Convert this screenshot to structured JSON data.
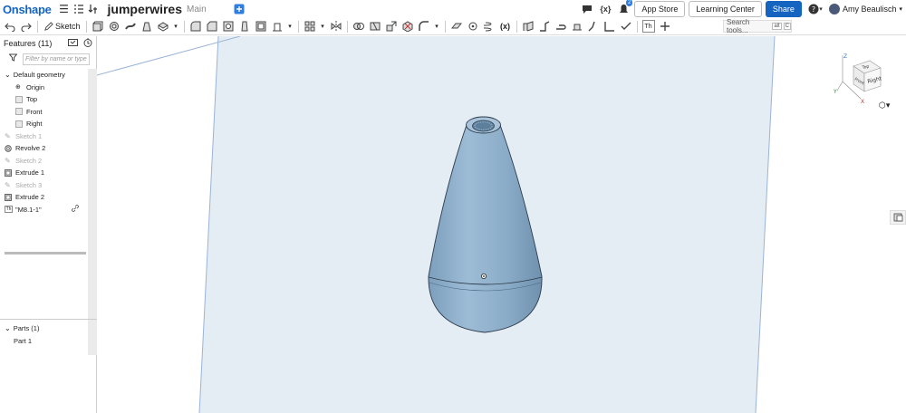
{
  "app": {
    "logo": "Onshape",
    "doc_name": "jumperwires",
    "branch": "Main"
  },
  "topbar": {
    "notification_count": "2",
    "app_store_label": "App Store",
    "learning_center_label": "Learning Center",
    "share_label": "Share",
    "user_name": "Amy Beaulisch"
  },
  "toolbar": {
    "sketch_label": "Sketch",
    "search_placeholder": "Search tools...",
    "search_kbd_1": "alt",
    "search_kbd_2": "C"
  },
  "features": {
    "header": "Features (11)",
    "filter_placeholder": "Filter by name or type",
    "tree": [
      {
        "label": "Default geometry",
        "type": "group",
        "dim": false
      },
      {
        "label": "Origin",
        "type": "origin",
        "dim": false
      },
      {
        "label": "Top",
        "type": "plane",
        "dim": false
      },
      {
        "label": "Front",
        "type": "plane",
        "dim": false
      },
      {
        "label": "Right",
        "type": "plane",
        "dim": false
      },
      {
        "label": "Sketch 1",
        "type": "sketch",
        "dim": true
      },
      {
        "label": "Revolve 2",
        "type": "revolve",
        "dim": false
      },
      {
        "label": "Sketch 2",
        "type": "sketch",
        "dim": true
      },
      {
        "label": "Extrude 1",
        "type": "extrude",
        "dim": false
      },
      {
        "label": "Sketch 3",
        "type": "sketch",
        "dim": true
      },
      {
        "label": "Extrude 2",
        "type": "extrude",
        "dim": false
      },
      {
        "label": "\"M8.1-1\"",
        "type": "thread",
        "dim": false
      }
    ]
  },
  "parts": {
    "header": "Parts (1)",
    "items": [
      "Part 1"
    ]
  },
  "view_cube": {
    "top_label": "Top",
    "front_label": "Front",
    "right_label": "Right",
    "axis_z": "Z",
    "axis_x": "X",
    "axis_y": "Y"
  },
  "colors": {
    "part_fill": "#8fb0c9",
    "part_shadow": "#6b8eab",
    "accent": "#1565c0",
    "plane_line": "#9ab4d6",
    "plane_fill": "#e3ebf3"
  }
}
